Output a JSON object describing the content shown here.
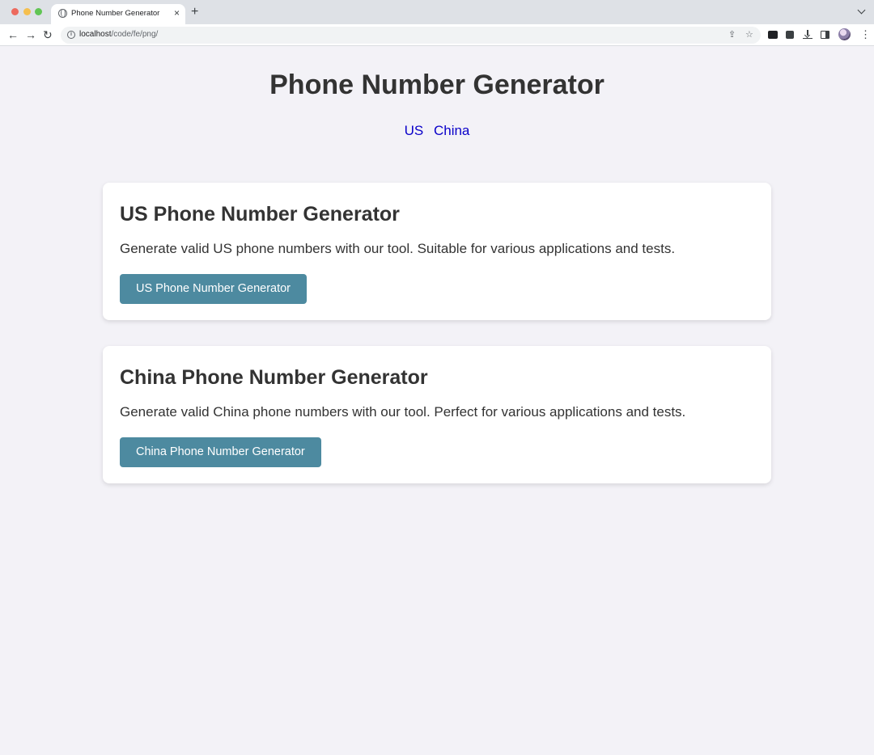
{
  "browser": {
    "tab_title": "Phone Number Generator",
    "tab_close": "×",
    "new_tab": "+",
    "url_host": "localhost",
    "url_path": "/code/fe/png/",
    "back": "←",
    "forward": "→",
    "reload": "↻",
    "share": "⇪",
    "star": "☆",
    "menu": "⋮"
  },
  "page": {
    "title": "Phone Number Generator",
    "nav": [
      {
        "label": "US"
      },
      {
        "label": "China"
      }
    ]
  },
  "cards": [
    {
      "heading": "US Phone Number Generator",
      "description": "Generate valid US phone numbers with our tool. Suitable for various applications and tests.",
      "button_label": "US Phone Number Generator"
    },
    {
      "heading": "China Phone Number Generator",
      "description": "Generate valid China phone numbers with our tool. Perfect for various applications and tests.",
      "button_label": "China Phone Number Generator"
    }
  ],
  "colors": {
    "page_background": "#f3f2f7",
    "button": "#4d8aa0",
    "nav_link": "#0a00c9",
    "text": "#333333"
  }
}
